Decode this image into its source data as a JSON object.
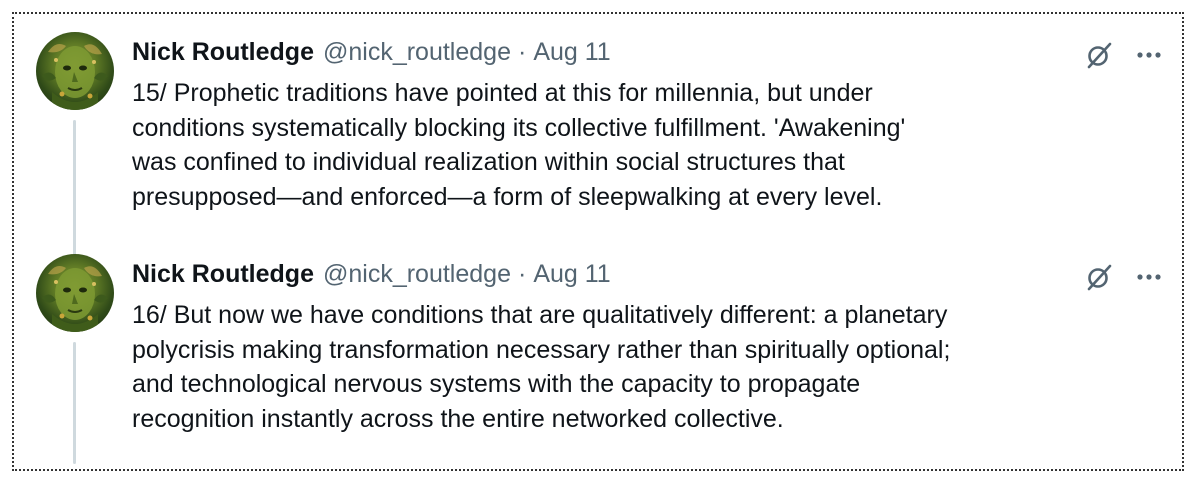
{
  "tweets": [
    {
      "author_name": "Nick Routledge",
      "handle": "@nick_routledge",
      "separator": "·",
      "date": "Aug 11",
      "avatar_icon": "avatar-image",
      "lines": [
        "15/ Prophetic traditions have pointed at this for millennia, but under",
        "conditions systematically blocking its collective fulfillment. 'Awakening'",
        "was confined to individual realization within social structures that",
        "presupposed—and enforced—a form of sleepwalking at every level."
      ]
    },
    {
      "author_name": "Nick Routledge",
      "handle": "@nick_routledge",
      "separator": "·",
      "date": "Aug 11",
      "avatar_icon": "avatar-image",
      "lines": [
        "16/ But now we have conditions that are qualitatively different: a planetary",
        "polycrisis making transformation necessary rather than spiritually optional;",
        "and technological nervous systems with the capacity to propagate",
        "recognition instantly across the entire networked collective."
      ]
    }
  ],
  "icons": {
    "grok": "grok-icon",
    "more": "more-options-icon"
  },
  "colors": {
    "text": "#0f1419",
    "muted": "#536471",
    "thread_line": "#cfd9de"
  }
}
